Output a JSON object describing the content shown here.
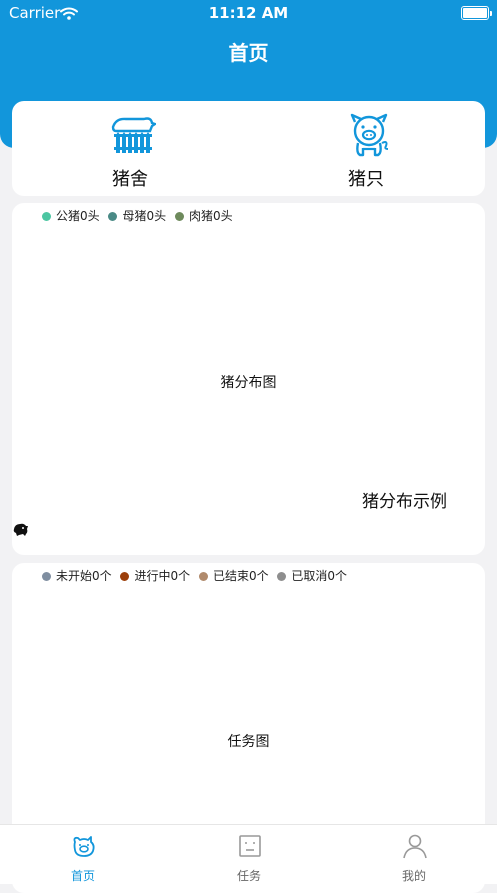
{
  "status_bar": {
    "carrier": "Carrier",
    "time": "11:12 AM"
  },
  "header": {
    "title": "首页"
  },
  "nav": {
    "items": [
      {
        "label": "猪舍",
        "icon": "pig-pen-icon"
      },
      {
        "label": "猪只",
        "icon": "pig-icon"
      }
    ]
  },
  "pig_chart": {
    "legend": [
      {
        "label": "公猪0头",
        "color": "#4cc6a2"
      },
      {
        "label": "母猪0头",
        "color": "#4a8a86"
      },
      {
        "label": "肉猪0头",
        "color": "#6e8a5c"
      }
    ],
    "title": "猪分布图",
    "caption": "猪分布示例"
  },
  "task_chart": {
    "legend": [
      {
        "label": "未开始0个",
        "color": "#7f8ea0"
      },
      {
        "label": "进行中0个",
        "color": "#9c3f0a"
      },
      {
        "label": "已结束0个",
        "color": "#b08a6c"
      },
      {
        "label": "已取消0个",
        "color": "#8e8e8e"
      }
    ],
    "title": "任务图"
  },
  "chart_data": [
    {
      "type": "pie",
      "title": "猪分布图",
      "categories": [
        "公猪",
        "母猪",
        "肉猪"
      ],
      "values": [
        0,
        0,
        0
      ],
      "legend_position": "top-left"
    },
    {
      "type": "pie",
      "title": "任务图",
      "categories": [
        "未开始",
        "进行中",
        "已结束",
        "已取消"
      ],
      "values": [
        0,
        0,
        0,
        0
      ],
      "legend_position": "top-left"
    }
  ],
  "tabbar": {
    "tabs": [
      {
        "label": "首页",
        "icon": "home-pig-icon",
        "active": true
      },
      {
        "label": "任务",
        "icon": "task-icon",
        "active": false
      },
      {
        "label": "我的",
        "icon": "user-icon",
        "active": false
      }
    ]
  },
  "colors": {
    "primary": "#1296db",
    "background": "#f2f2f4"
  }
}
